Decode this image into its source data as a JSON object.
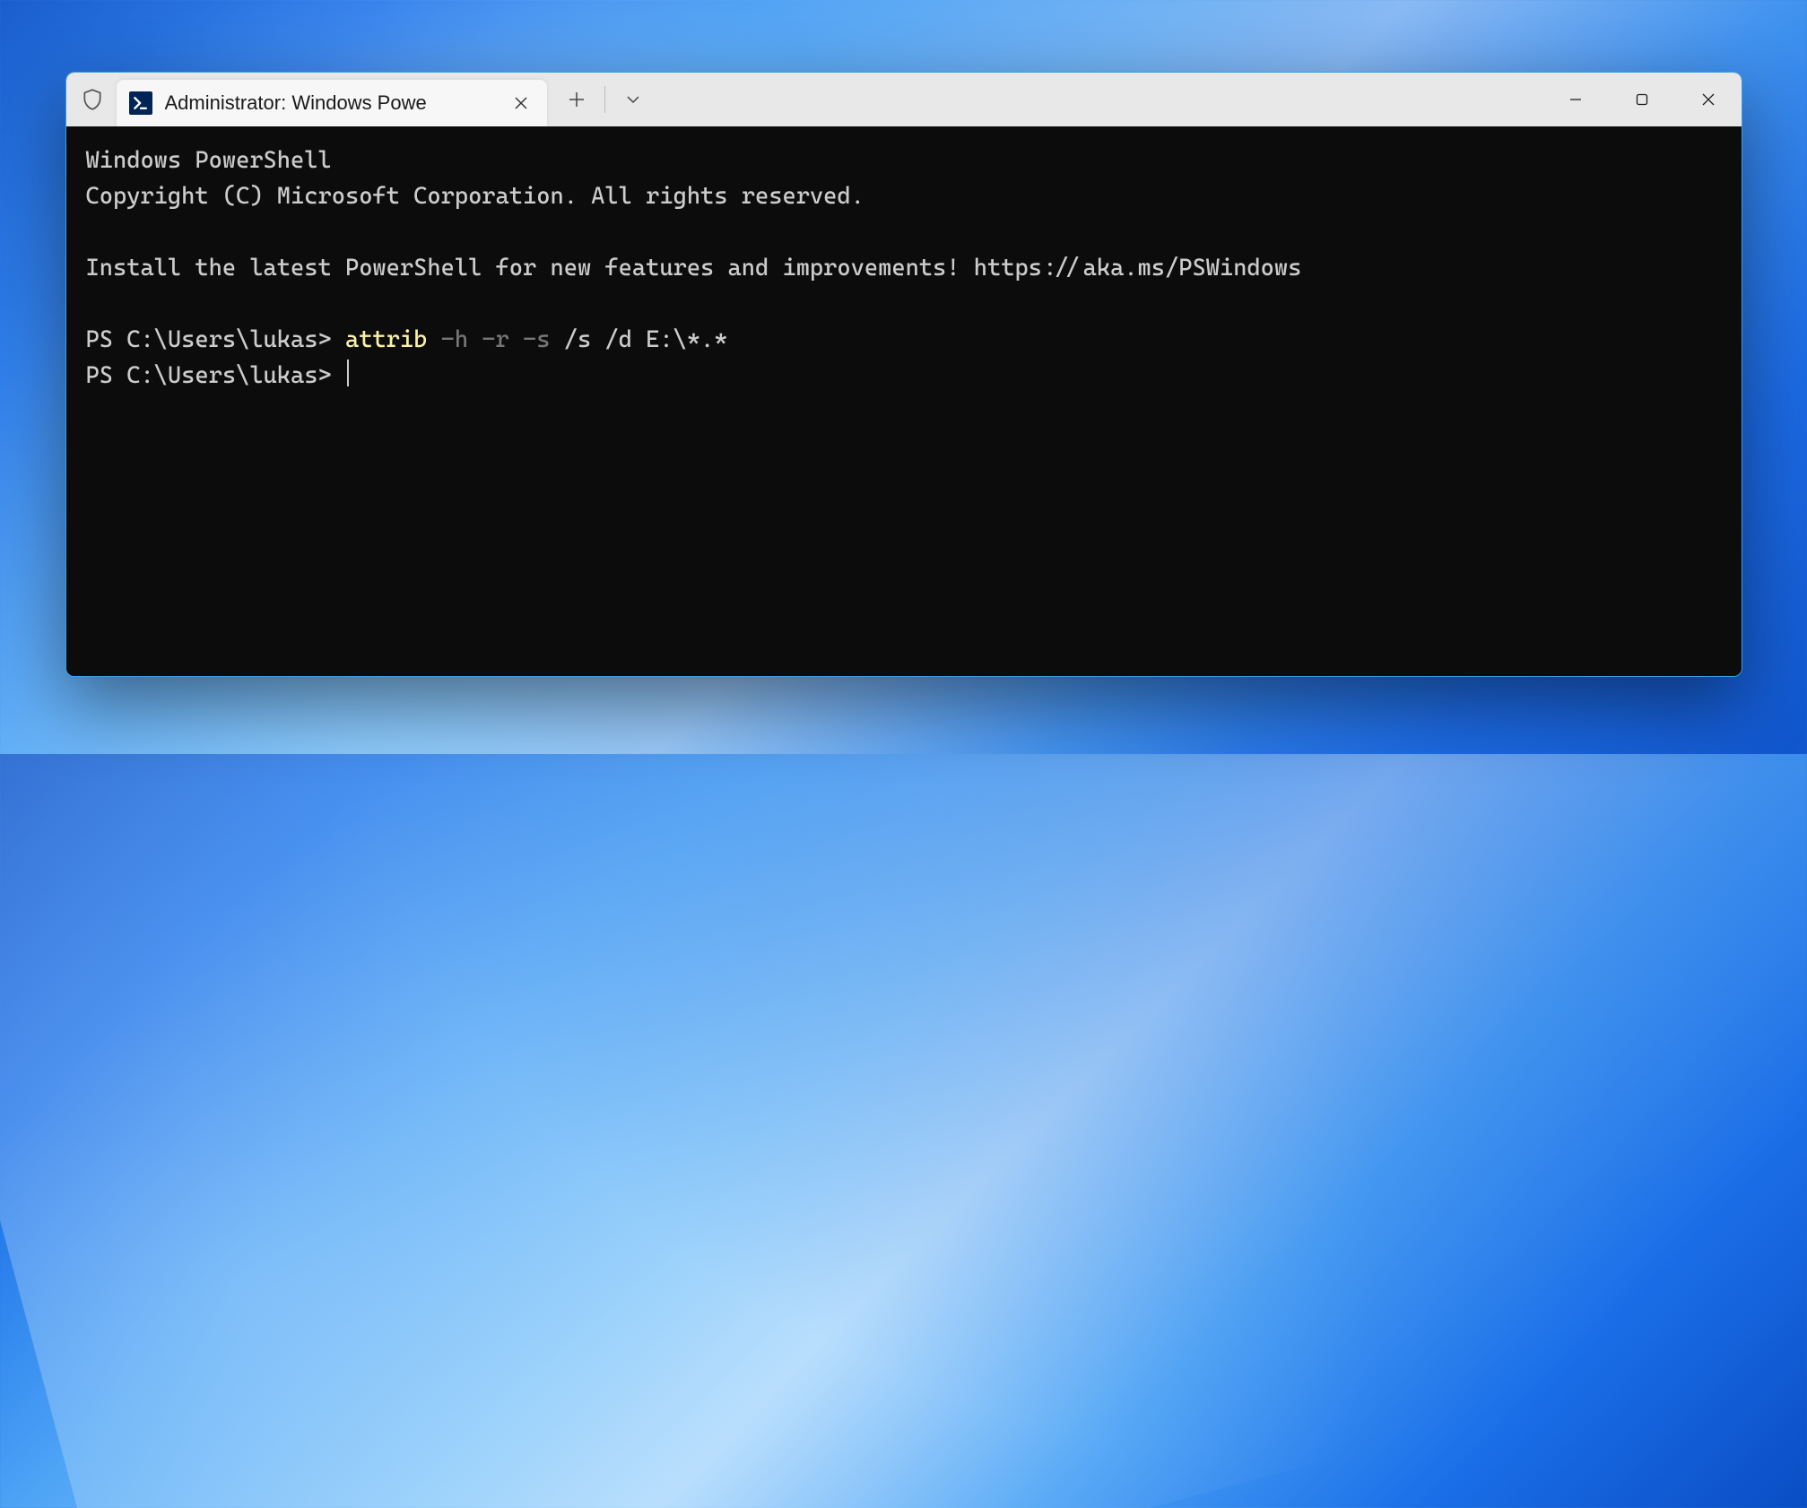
{
  "window": {
    "tab_title": "Administrator: Windows Powe"
  },
  "terminal": {
    "line1": "Windows PowerShell",
    "line2": "Copyright (C) Microsoft Corporation. All rights reserved.",
    "line3": "Install the latest PowerShell for new features and improvements! https://aka.ms/PSWindows",
    "prompt1_prefix": "PS C:\\Users\\lukas> ",
    "prompt1_cmd": "attrib",
    "prompt1_flags": " -h -r -s",
    "prompt1_args": " /s /d E:\\*.*",
    "prompt2_prefix": "PS C:\\Users\\lukas> "
  }
}
